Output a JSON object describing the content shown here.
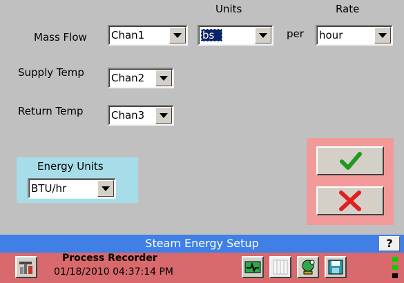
{
  "headers": {
    "units": "Units",
    "rate": "Rate"
  },
  "mass_flow": {
    "label": "Mass Flow",
    "channel": "Chan1",
    "units": "bs",
    "per_label": "per",
    "rate": "hour"
  },
  "supply_temp": {
    "label": "Supply Temp",
    "channel": "Chan2"
  },
  "return_temp": {
    "label": "Return Temp",
    "channel": "Chan3"
  },
  "energy_units": {
    "label": "Energy Units",
    "value": "BTU/hr"
  },
  "title_bar": {
    "title": "Steam Energy Setup",
    "help_label": "?"
  },
  "status_bar": {
    "app_name": "Process Recorder",
    "datetime": "01/18/2010 04:37:14 PM"
  },
  "colors": {
    "background": "#c0c0c0",
    "title_bar": "#3f7fe6",
    "status_bar": "#d8696c",
    "energy_panel": "#a7dde8",
    "action_panel": "#f29a9a",
    "ok_check": "#1f9a1f",
    "cancel_x": "#e02020"
  }
}
